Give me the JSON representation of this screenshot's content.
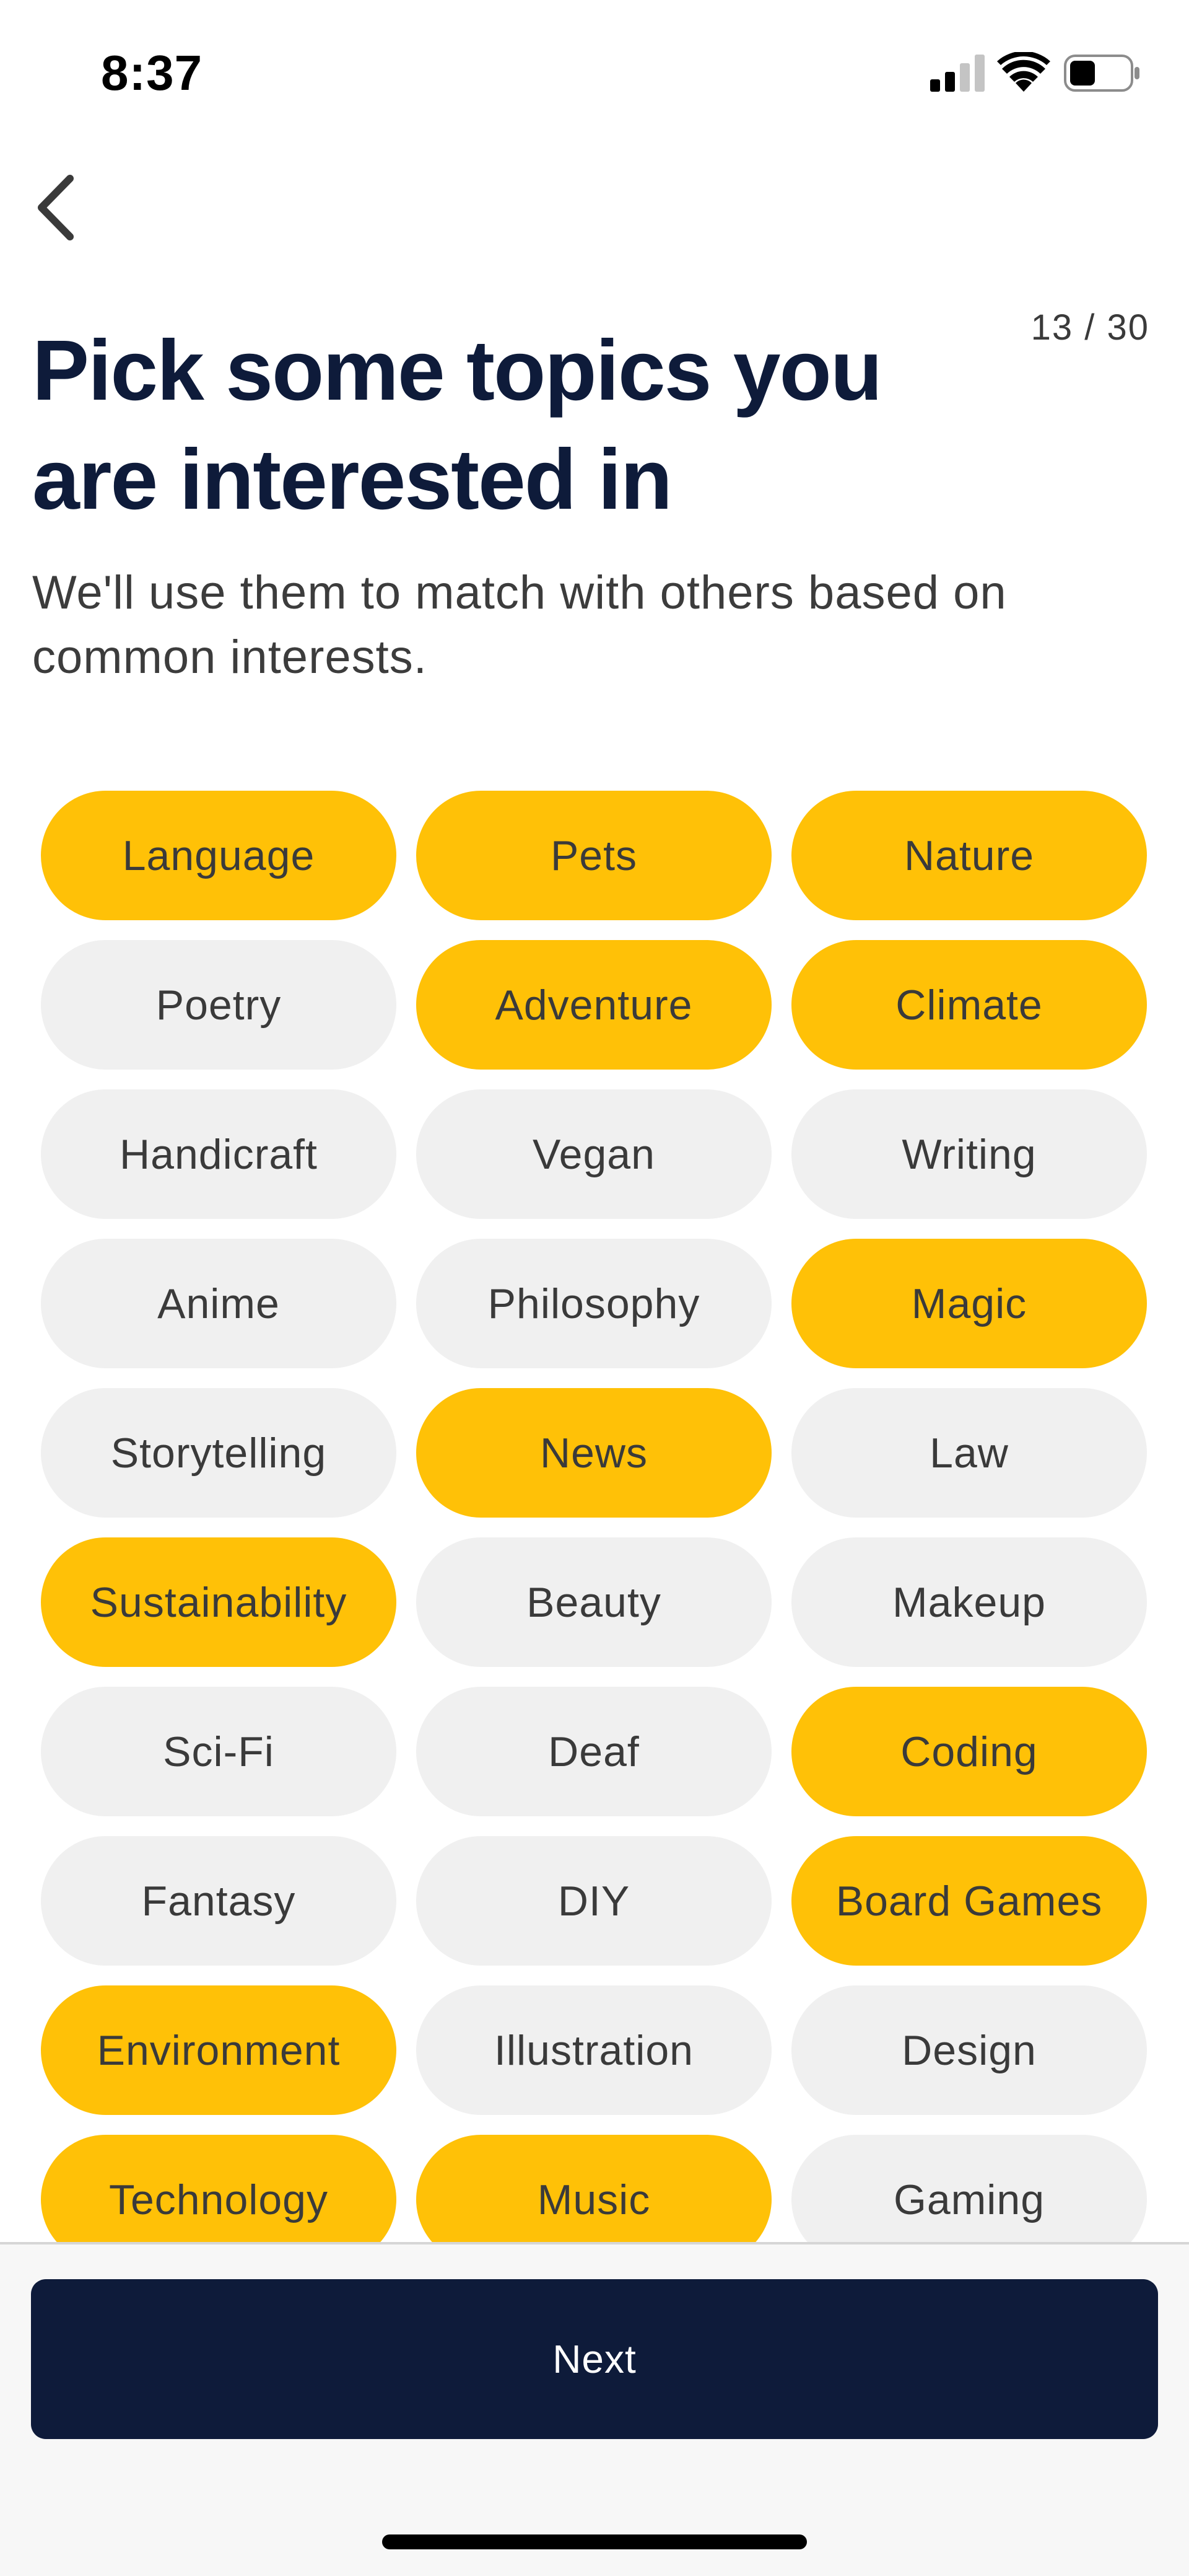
{
  "status_bar": {
    "time": "8:37"
  },
  "header": {
    "progress": "13 / 30",
    "title": "Pick some topics you are interested in",
    "subtitle": "We'll use them to match with others based on common interests."
  },
  "topics": [
    {
      "label": "Language",
      "selected": true
    },
    {
      "label": "Pets",
      "selected": true
    },
    {
      "label": "Nature",
      "selected": true
    },
    {
      "label": "Poetry",
      "selected": false
    },
    {
      "label": "Adventure",
      "selected": true
    },
    {
      "label": "Climate",
      "selected": true
    },
    {
      "label": "Handicraft",
      "selected": false
    },
    {
      "label": "Vegan",
      "selected": false
    },
    {
      "label": "Writing",
      "selected": false
    },
    {
      "label": "Anime",
      "selected": false
    },
    {
      "label": "Philosophy",
      "selected": false
    },
    {
      "label": "Magic",
      "selected": true
    },
    {
      "label": "Storytelling",
      "selected": false
    },
    {
      "label": "News",
      "selected": true
    },
    {
      "label": "Law",
      "selected": false
    },
    {
      "label": "Sustainability",
      "selected": true
    },
    {
      "label": "Beauty",
      "selected": false
    },
    {
      "label": "Makeup",
      "selected": false
    },
    {
      "label": "Sci-Fi",
      "selected": false
    },
    {
      "label": "Deaf",
      "selected": false
    },
    {
      "label": "Coding",
      "selected": true
    },
    {
      "label": "Fantasy",
      "selected": false
    },
    {
      "label": "DIY",
      "selected": false
    },
    {
      "label": "Board Games",
      "selected": true
    },
    {
      "label": "Environment",
      "selected": true
    },
    {
      "label": "Illustration",
      "selected": false
    },
    {
      "label": "Design",
      "selected": false
    },
    {
      "label": "Technology",
      "selected": true
    },
    {
      "label": "Music",
      "selected": true
    },
    {
      "label": "Gaming",
      "selected": false
    }
  ],
  "footer": {
    "next_label": "Next"
  },
  "colors": {
    "selected_chip": "#ffc107",
    "unselected_chip": "#f0f0f0",
    "primary_dark": "#0e1b3a"
  },
  "icons": {
    "back": "chevron-left-icon",
    "signal": "cellular-signal-icon",
    "wifi": "wifi-icon",
    "battery": "battery-icon"
  }
}
